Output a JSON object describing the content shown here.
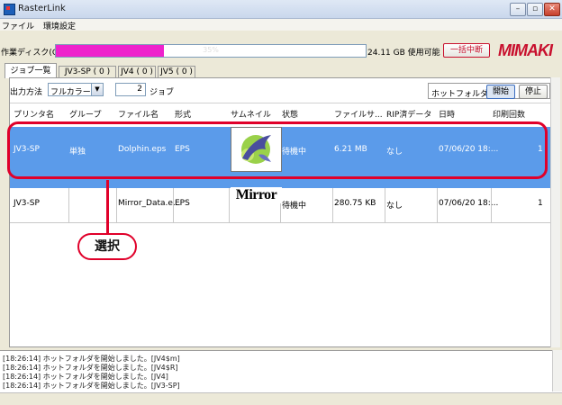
{
  "window": {
    "title": "RasterLink",
    "controls": [
      "–",
      "▫",
      "✕"
    ]
  },
  "menu": [
    "ファイル",
    "環境設定"
  ],
  "disk": {
    "label": "作業ディスク(C:)",
    "usage_percent": 35,
    "usage_text": "35%",
    "free_text": "24.11 GB 使用可能",
    "stop_all_label": "一括中断",
    "brand": "MIMAKI"
  },
  "tabs": [
    "ジョブ一覧",
    "JV3-SP ( 0 )",
    "JV4 ( 0 )",
    "JV5 ( 0 )"
  ],
  "filter": {
    "label": "出力方法",
    "mode": "フルカラー",
    "count": "2",
    "count_unit": "ジョブ"
  },
  "hotfolder": {
    "label": "ホットフォルダ",
    "start_label": "開始",
    "stop_label": "停止"
  },
  "table": {
    "headers": [
      "プリンタ名",
      "グループ",
      "ファイル名",
      "形式",
      "サムネイル",
      "状態",
      "ファイルサ...",
      "RIP済データ",
      "日時",
      "印刷回数"
    ],
    "rows": [
      {
        "printer": "JV3-SP",
        "group": "単独",
        "file": "Dolphin.eps",
        "format": "EPS",
        "status": "待機中",
        "size": "6.21 MB",
        "rip": "なし",
        "date": "07/06/20 18:...",
        "count": "1"
      },
      {
        "printer": "JV3-SP",
        "group": "",
        "file": "Mirror_Data.e...",
        "format": "EPS",
        "thumb_text": "Mirror",
        "status": "待機中",
        "size": "280.75 KB",
        "rip": "なし",
        "date": "07/06/20 18:...",
        "count": "1"
      }
    ]
  },
  "callout": {
    "label": "選択"
  },
  "log": [
    "[18:26:14] ホットフォルダを開始しました。[JV4$m]",
    "[18:26:14] ホットフォルダを開始しました。[JV4$R]",
    "[18:26:14] ホットフォルダを開始しました。[JV4]",
    "[18:26:14] ホットフォルダを開始しました。[JV3-SP]"
  ],
  "colors": {
    "selection": "#5b9bea",
    "highlight": "#e0002a",
    "disk_fill": "#ee22cc",
    "brand": "#c8102e"
  }
}
